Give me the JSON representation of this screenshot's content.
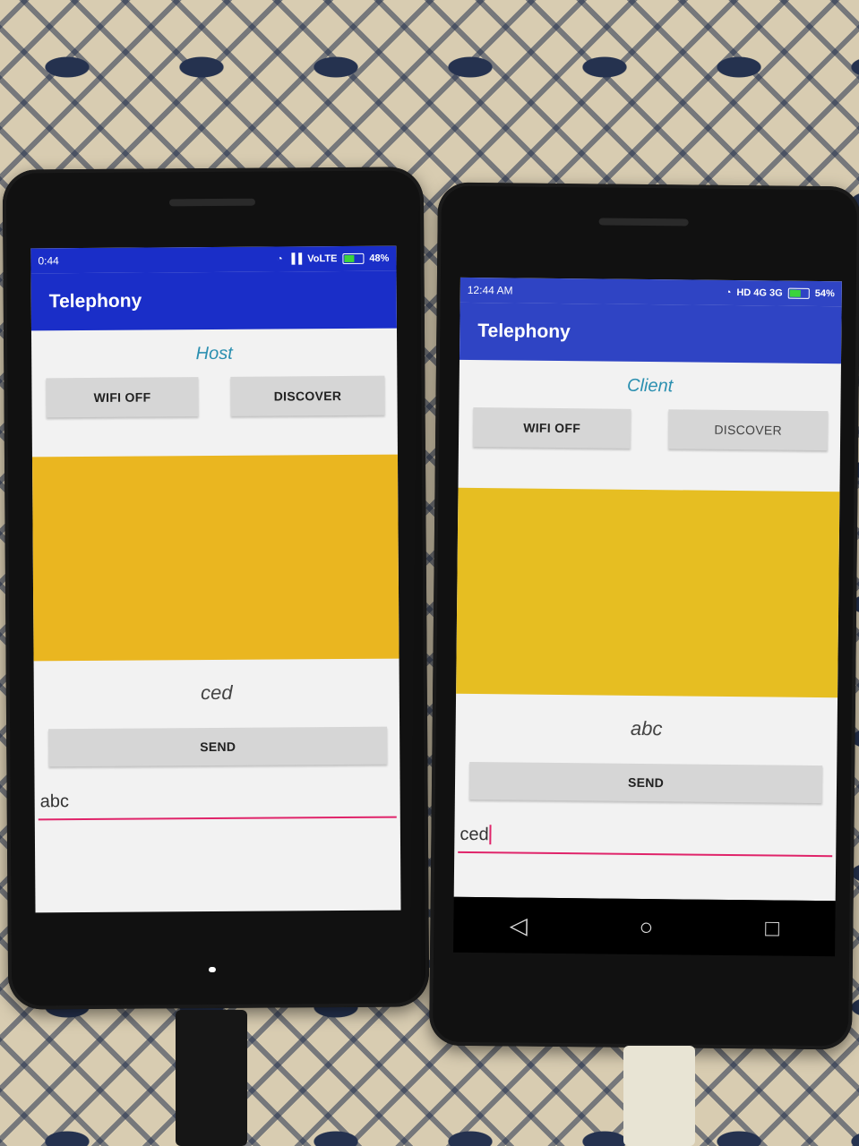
{
  "left_phone": {
    "status": {
      "time": "0:44",
      "network": "VoLTE",
      "battery": "48%"
    },
    "app_title": "Telephony",
    "role": "Host",
    "buttons": {
      "wifi": "WIFI OFF",
      "discover": "DISCOVER",
      "send": "SEND"
    },
    "received_message": "ced",
    "input_value": "abc"
  },
  "right_phone": {
    "status": {
      "time": "12:44 AM",
      "network": "HD 4G 3G",
      "battery": "54%"
    },
    "app_title": "Telephony",
    "role": "Client",
    "buttons": {
      "wifi": "WIFI OFF",
      "discover": "DISCOVER",
      "send": "SEND"
    },
    "received_message": "abc",
    "input_value": "ced",
    "navbar_icons": [
      "back-icon",
      "home-icon",
      "recents-icon"
    ]
  },
  "colors": {
    "appbar": "#1a2ec8",
    "yellow_panel": "#eab620",
    "role_text": "#2a8fb0",
    "input_underline": "#e0246a"
  }
}
